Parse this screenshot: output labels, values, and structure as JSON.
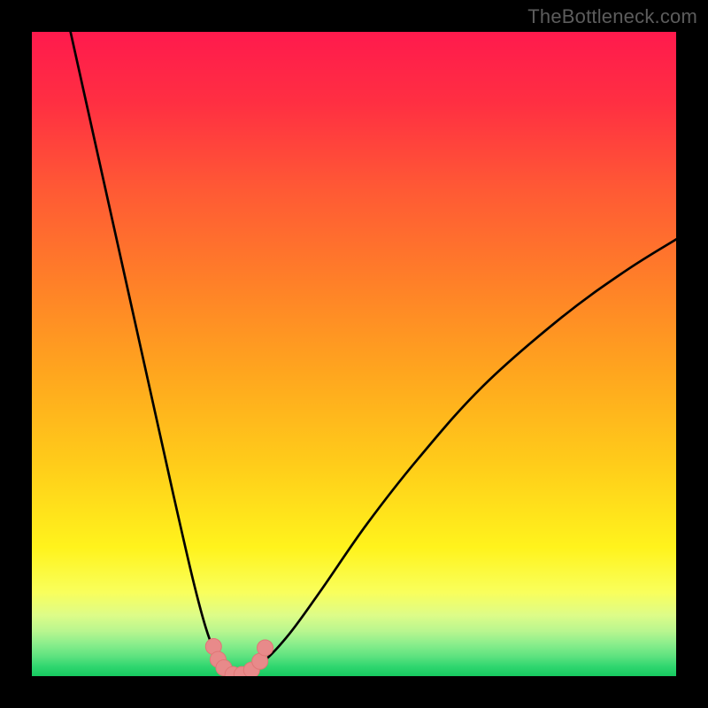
{
  "attribution": "TheBottleneck.com",
  "colors": {
    "frame": "#000000",
    "curve": "#000000",
    "marker": "#e88a8a",
    "marker_stroke": "#e07676",
    "gradient_top": "#ff1a4d",
    "gradient_bottom": "#16cb60"
  },
  "chart_data": {
    "type": "line",
    "title": "",
    "xlabel": "",
    "ylabel": "",
    "xlim": [
      0,
      100
    ],
    "ylim": [
      0,
      100
    ],
    "series": [
      {
        "name": "left-branch",
        "x": [
          6,
          10,
          14,
          18,
          22,
          25,
          27,
          28.5,
          29.7,
          30.5,
          31.2
        ],
        "y": [
          100,
          82,
          64,
          46,
          28,
          15,
          7.5,
          3.5,
          1.6,
          0.6,
          0.15
        ]
      },
      {
        "name": "right-branch",
        "x": [
          31.2,
          33,
          36,
          40,
          45,
          52,
          60,
          70,
          82,
          92,
          100
        ],
        "y": [
          0.15,
          0.6,
          2.3,
          6.6,
          13.5,
          23.6,
          33.8,
          45,
          55.5,
          62.8,
          67.8
        ]
      }
    ],
    "markers": {
      "name": "highlight-points",
      "x": [
        28.2,
        28.9,
        29.8,
        31.2,
        32.6,
        34.1,
        35.4,
        36.2
      ],
      "y": [
        4.6,
        2.6,
        1.3,
        0.25,
        0.25,
        0.95,
        2.3,
        4.4
      ]
    }
  }
}
